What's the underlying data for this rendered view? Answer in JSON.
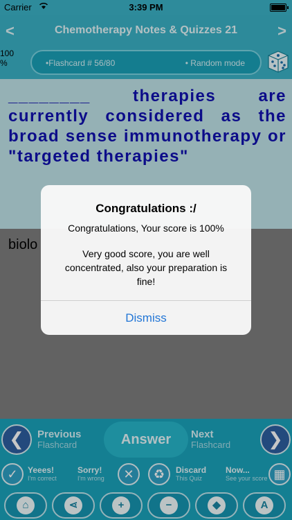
{
  "status_bar": {
    "carrier": "Carrier",
    "time": "3:39 PM"
  },
  "nav": {
    "title": "Chemotherapy Notes & Quizzes 21",
    "back_arrow": "<",
    "forward_arrow": ">"
  },
  "subbar": {
    "score_line1": "100",
    "score_line2": "%",
    "flashcard_label": "•Flashcard #  56/80",
    "mode_label": "• Random mode"
  },
  "question": {
    "text": "________ therapies are currently considered as the broad sense immunotherapy or \"targeted therapies\""
  },
  "answer": {
    "text": "biolo"
  },
  "alert": {
    "title": "Congratulations :/",
    "message1": "Congratulations, Your score is 100%",
    "message2": "Very good score, you are well concentrated, also your preparation is fine!",
    "dismiss_label": "Dismiss"
  },
  "controls": {
    "previous_line1": "Previous",
    "previous_line2": "Flashcard",
    "answer_label": "Answer",
    "next_line1": "Next",
    "next_line2": "Flashcard"
  },
  "mini_buttons": [
    {
      "t1": "Yeees!",
      "t2": "I'm correct",
      "icon": "check-icon",
      "glyph": "✓"
    },
    {
      "t1": "Sorry!",
      "t2": "I'm wrong",
      "icon": "x-icon",
      "glyph": "✕"
    },
    {
      "t1": "Discard",
      "t2": "This Quiz",
      "icon": "recycle-icon",
      "glyph": "♻"
    },
    {
      "t1": "Now...",
      "t2": "See your score",
      "icon": "chart-icon",
      "glyph": "▦"
    }
  ],
  "toolbar": [
    {
      "icon": "home-icon",
      "glyph": "⌂"
    },
    {
      "icon": "share-icon",
      "glyph": "⋖"
    },
    {
      "icon": "zoom-in-icon",
      "glyph": "+"
    },
    {
      "icon": "zoom-out-icon",
      "glyph": "−"
    },
    {
      "icon": "bucket-icon",
      "glyph": "◆"
    },
    {
      "icon": "font-icon",
      "glyph": "A"
    }
  ],
  "colors": {
    "accent": "#1aa3bc",
    "question_text": "#1010b0",
    "dismiss": "#2276d6"
  }
}
